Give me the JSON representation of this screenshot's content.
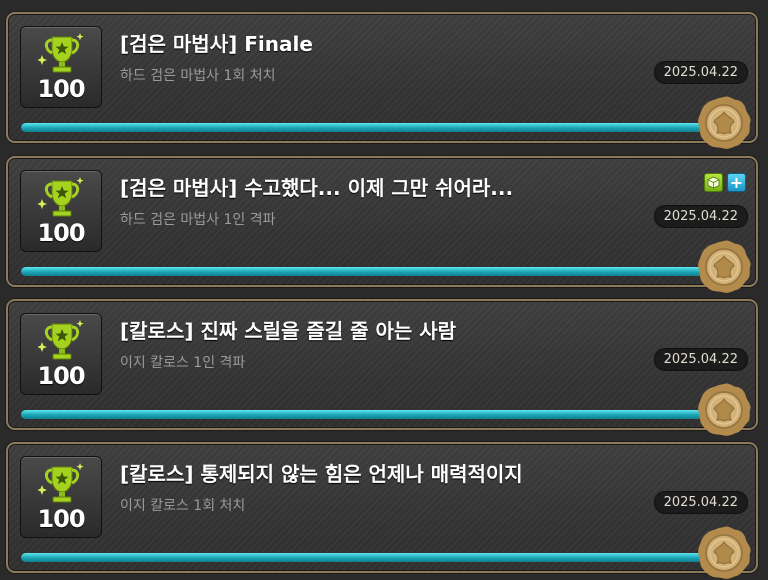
{
  "achievements": [
    {
      "title": "[검은 마법사] Finale",
      "desc": "하드 검은 마법사 1회 처치",
      "score": "100",
      "date": "2025.04.22",
      "progress": 1.0,
      "badges": []
    },
    {
      "title": "[검은 마법사] 수고했다... 이제 그만 쉬어라...",
      "desc": "하드 검은 마법사 1인 격파",
      "score": "100",
      "date": "2025.04.22",
      "progress": 1.0,
      "badges": [
        "box-icon",
        "plus-icon"
      ]
    },
    {
      "title": "[칼로스] 진짜 스릴을 즐길 줄 아는 사람",
      "desc": "이지 칼로스 1인 격파",
      "score": "100",
      "date": "2025.04.22",
      "progress": 1.0,
      "badges": []
    },
    {
      "title": "[칼로스] 통제되지 않는 힘은 언제나 매력적이지",
      "desc": "이지 칼로스 1회 처치",
      "score": "100",
      "date": "2025.04.22",
      "progress": 1.0,
      "badges": []
    }
  ],
  "colors": {
    "trophy": "#9fd021",
    "progress": "#2fc3d3",
    "seal": "#c9a566",
    "border": "#8a7a5a"
  }
}
